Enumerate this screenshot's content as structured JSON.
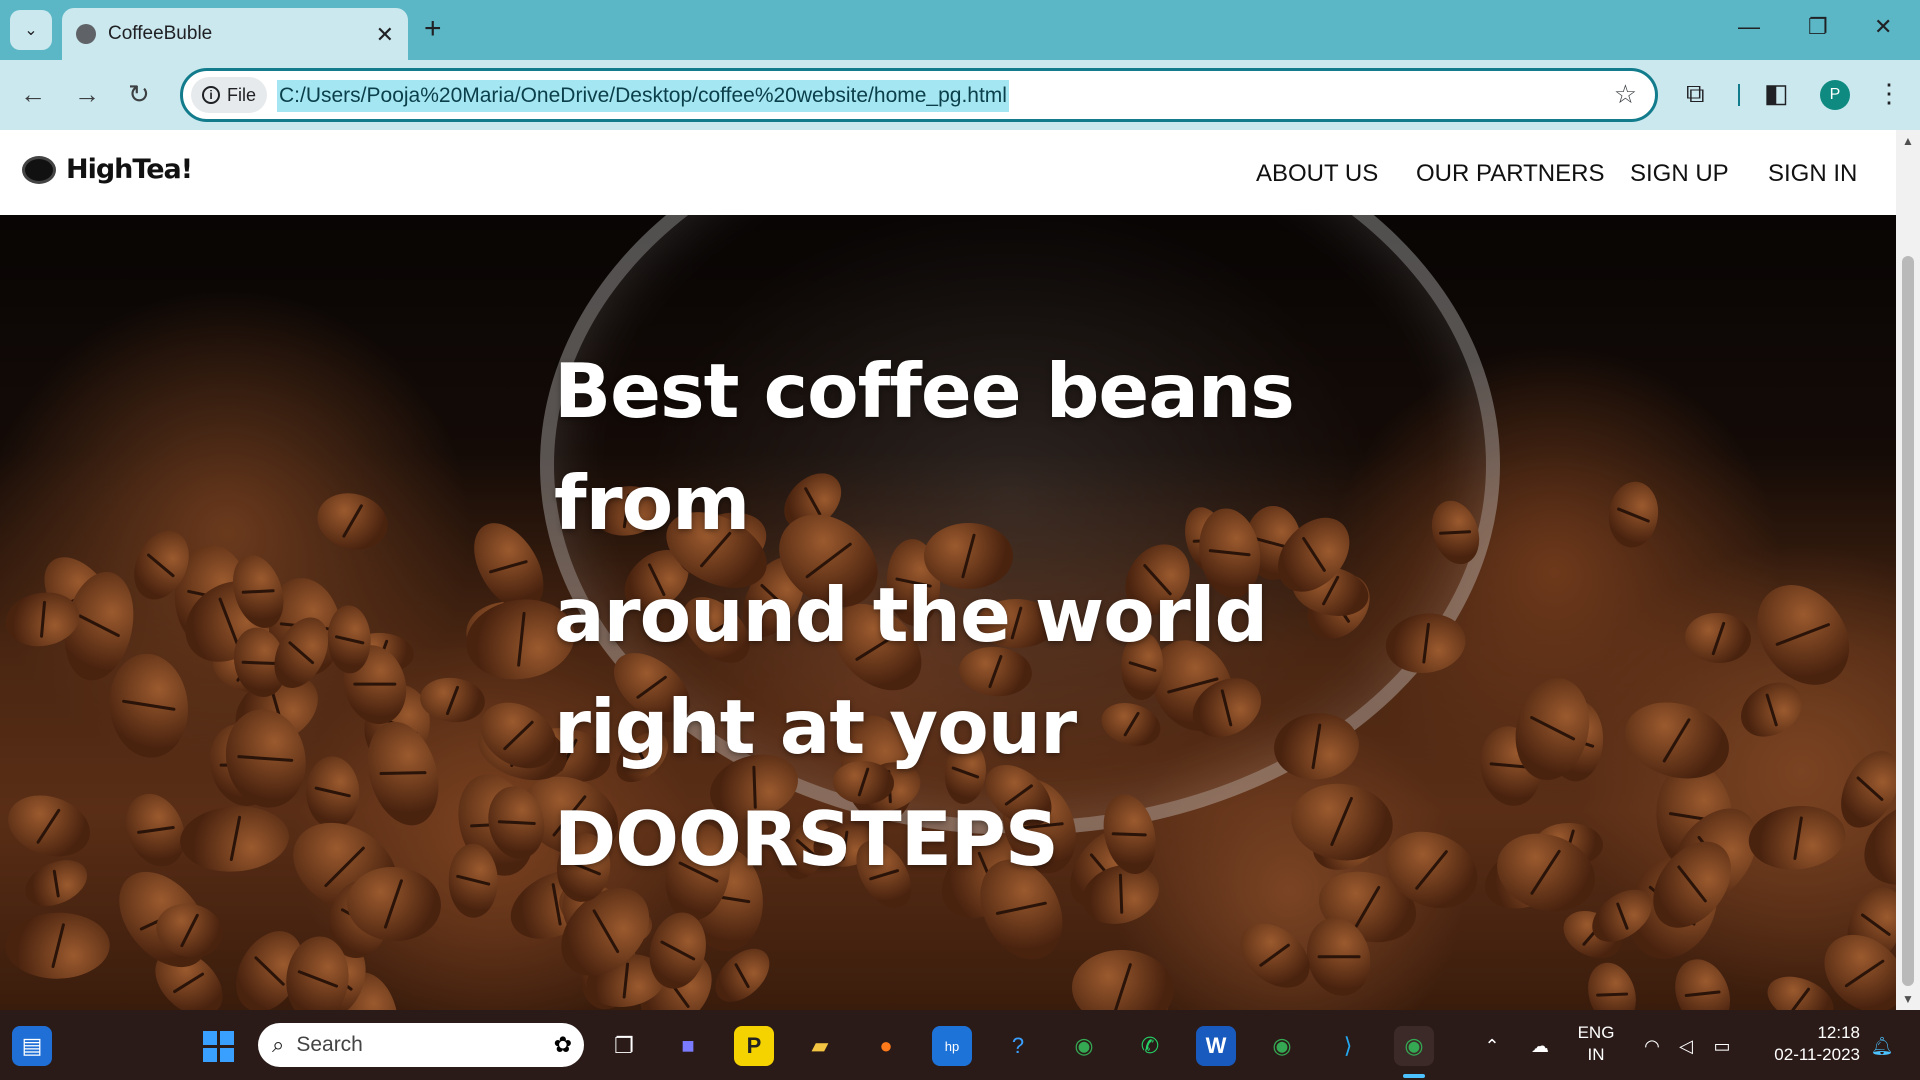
{
  "browser": {
    "tab_title": "CoffeeBuble",
    "omnibox_chip": "File",
    "url": "C:/Users/Pooja%20Maria/OneDrive/Desktop/coffee%20website/home_pg.html",
    "profile_initial": "P"
  },
  "site": {
    "logo_text": "HighTea!",
    "nav": [
      "ABOUT US",
      "OUR PARTNERS",
      "SIGN UP",
      "SIGN IN"
    ],
    "headline_lines": [
      "Best coffee beans from",
      "around the world",
      "right at your",
      "DOORSTEPS"
    ]
  },
  "taskbar": {
    "search_placeholder": "Search",
    "lang_top": "ENG",
    "lang_bottom": "IN",
    "time": "12:18",
    "date": "02-11-2023"
  },
  "colors": {
    "browser_frame": "#5bb6c5",
    "tab_active": "#cbe8ee",
    "omnibox_border": "#127c8c",
    "taskbar": "#2a1b18"
  }
}
